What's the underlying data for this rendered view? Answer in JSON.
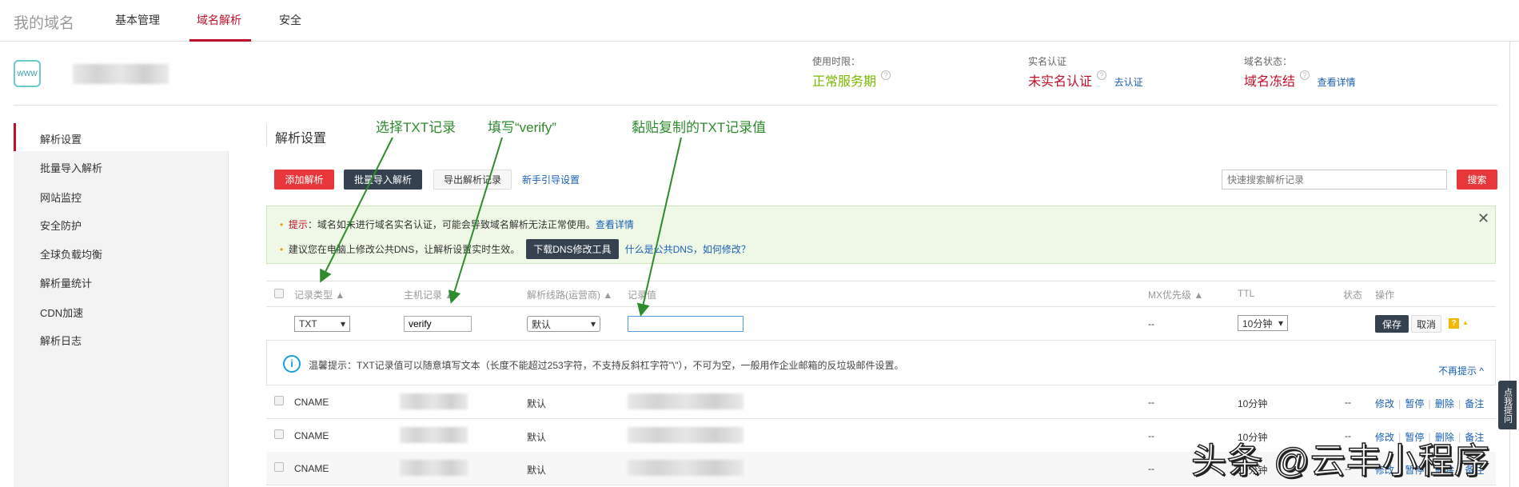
{
  "topnav": {
    "brand": "我的域名",
    "items": [
      "基本管理",
      "域名解析",
      "安全"
    ]
  },
  "domain_header": {
    "icon": "www-globe-icon",
    "usage": {
      "label": "使用时限：",
      "value": "正常服务期"
    },
    "realname": {
      "label": "实名认证",
      "value": "未实名认证",
      "link": "去认证"
    },
    "status": {
      "label": "域名状态：",
      "value": "域名冻结",
      "link": "查看详情"
    },
    "colors": {
      "ok": "#7ab800",
      "bad": "#c0102a",
      "link": "#1a5fb4"
    }
  },
  "sidebar": {
    "items": [
      "解析设置",
      "批量导入解析",
      "网站监控",
      "安全防护",
      "全球负载均衡",
      "解析量统计",
      "CDN加速",
      "解析日志"
    ]
  },
  "main": {
    "title": "解析设置",
    "toolbar": {
      "add": "添加解析",
      "batch": "批量导入解析",
      "export": "导出解析记录",
      "guide": "新手引导设置",
      "search_placeholder": "快速搜索解析记录",
      "search": "搜索"
    },
    "alert": {
      "tip_label": "提示",
      "tip_text": "：域名如未进行域名实名认证，可能会导致域名解析无法正常使用。",
      "tip_link": "查看详情",
      "dns_text": "建议您在电脑上修改公共DNS，让解析设置实时生效。",
      "dns_button": "下载DNS修改工具",
      "dns_link": "什么是公共DNS，如何修改？"
    },
    "columns": [
      "记录类型 ▲",
      "主机记录 ▲",
      "解析线路(运营商) ▲",
      "记录值",
      "MX优先级 ▲",
      "TTL",
      "状态",
      "操作"
    ],
    "edit_row": {
      "type": "TXT",
      "host": "verify",
      "line": "默认",
      "value": "",
      "mx": "--",
      "ttl": "10分钟",
      "save": "保存",
      "cancel": "取消"
    },
    "hint": {
      "text": "温馨提示：TXT记录值可以随意填写文本（长度不能超过253字符，不支持反斜杠字符\"\\\"），不可为空，一般用作企业邮箱的反垃圾邮件设置。",
      "dismiss": "不再提示 ^"
    },
    "rows": [
      {
        "type": "CNAME",
        "line": "默认",
        "mx": "--",
        "ttl": "10分钟",
        "status": "--"
      },
      {
        "type": "CNAME",
        "line": "默认",
        "mx": "--",
        "ttl": "10分钟",
        "status": "--"
      },
      {
        "type": "CNAME",
        "line": "默认",
        "mx": "--",
        "ttl": "10分钟",
        "status": "--"
      }
    ],
    "row_actions": [
      "修改",
      "暂停",
      "删除",
      "备注"
    ]
  },
  "annotations": [
    "选择TXT记录",
    "填写“verify”",
    "黏贴复制的TXT记录值"
  ],
  "side_tab": "点我提问",
  "watermark": "头条 @云丰小程序"
}
